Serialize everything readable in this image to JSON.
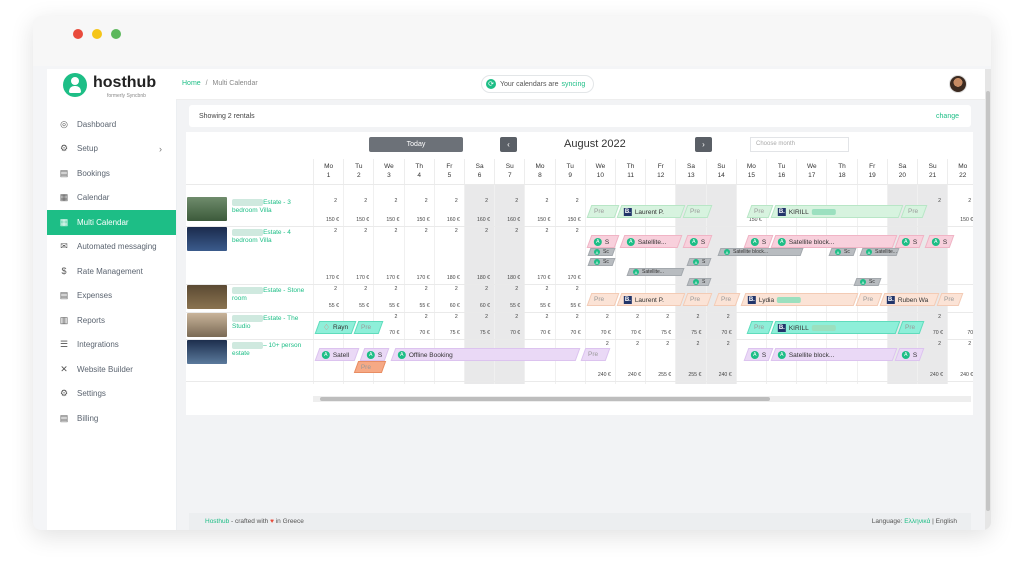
{
  "window": {
    "controls": [
      "close",
      "minimize",
      "maximize"
    ],
    "control_colors": [
      "#e94b3c",
      "#f5c518",
      "#5cb85c"
    ]
  },
  "brand": {
    "name": "hosthub",
    "tagline": "formerly Syncbnb"
  },
  "sidebar": {
    "items": [
      {
        "label": "Dashboard",
        "icon": "dashboard-icon",
        "glyph": "◎"
      },
      {
        "label": "Setup",
        "icon": "gears-icon",
        "glyph": "⚙",
        "chevron": "›"
      },
      {
        "label": "Bookings",
        "icon": "bookings-icon",
        "glyph": "▤"
      },
      {
        "label": "Calendar",
        "icon": "calendar-icon",
        "glyph": "▦"
      },
      {
        "label": "Multi Calendar",
        "icon": "multi-calendar-icon",
        "glyph": "▦",
        "active": true
      },
      {
        "label": "Automated messaging",
        "icon": "envelope-icon",
        "glyph": "✉"
      },
      {
        "label": "Rate Management",
        "icon": "dollar-icon",
        "glyph": "$"
      },
      {
        "label": "Expenses",
        "icon": "receipt-icon",
        "glyph": "▤"
      },
      {
        "label": "Reports",
        "icon": "chart-icon",
        "glyph": "▥"
      },
      {
        "label": "Integrations",
        "icon": "database-icon",
        "glyph": "☰"
      },
      {
        "label": "Website Builder",
        "icon": "tools-icon",
        "glyph": "✕"
      },
      {
        "label": "Settings",
        "icon": "gear-icon",
        "glyph": "⚙"
      },
      {
        "label": "Billing",
        "icon": "file-icon",
        "glyph": "▤"
      }
    ]
  },
  "topbar": {
    "breadcrumb_home": "Home",
    "breadcrumb_sep": "/",
    "breadcrumb_current": "Multi Calendar",
    "sync_text": "Your calendars are",
    "sync_state": "syncing"
  },
  "rentals_bar": {
    "showing": "Showing 2 rentals",
    "change": "change"
  },
  "calendar": {
    "today_label": "Today",
    "prev": "‹",
    "next": "›",
    "month": "August 2022",
    "month_placeholder": "Choose month",
    "days": [
      {
        "d": "Mo",
        "n": "1"
      },
      {
        "d": "Tu",
        "n": "2"
      },
      {
        "d": "We",
        "n": "3"
      },
      {
        "d": "Th",
        "n": "4"
      },
      {
        "d": "Fr",
        "n": "5"
      },
      {
        "d": "Sa",
        "n": "6",
        "w": true
      },
      {
        "d": "Su",
        "n": "7",
        "w": true
      },
      {
        "d": "Mo",
        "n": "8"
      },
      {
        "d": "Tu",
        "n": "9"
      },
      {
        "d": "We",
        "n": "10"
      },
      {
        "d": "Th",
        "n": "11"
      },
      {
        "d": "Fr",
        "n": "12"
      },
      {
        "d": "Sa",
        "n": "13",
        "w": true
      },
      {
        "d": "Su",
        "n": "14",
        "w": true
      },
      {
        "d": "Mo",
        "n": "15"
      },
      {
        "d": "Tu",
        "n": "16"
      },
      {
        "d": "We",
        "n": "17"
      },
      {
        "d": "Th",
        "n": "18"
      },
      {
        "d": "Fr",
        "n": "19"
      },
      {
        "d": "Sa",
        "n": "20",
        "w": true
      },
      {
        "d": "Su",
        "n": "21",
        "w": true
      },
      {
        "d": "Mo",
        "n": "22"
      }
    ],
    "rentals": [
      {
        "name_suffix": "Estate - 3 bedroom Villa",
        "photo": "villa-photo",
        "min_stay": [
          "2",
          "2",
          "2",
          "2",
          "2",
          "2",
          "2",
          "2",
          "2",
          "",
          "",
          "",
          "",
          "",
          "",
          "",
          "",
          "",
          "",
          "",
          "2",
          "2"
        ],
        "prices": [
          "150 €",
          "150 €",
          "150 €",
          "150 €",
          "160 €",
          "160 €",
          "160 €",
          "150 €",
          "150 €",
          "",
          "",
          "",
          "",
          "",
          "150 €",
          "",
          "",
          "",
          "",
          "",
          "",
          "150 €"
        ],
        "bookings": [
          {
            "label": "Pre",
            "color": "green",
            "start": 9,
            "span": 1.0,
            "kind": "pre"
          },
          {
            "label": "Laurent P.",
            "color": "green",
            "start": 10,
            "span": 2.2,
            "kind": "booking"
          },
          {
            "label": "Pre",
            "color": "green",
            "start": 12.2,
            "span": 0.9,
            "kind": "pre"
          },
          {
            "label": "Pre",
            "color": "green",
            "start": 14.3,
            "span": 0.8,
            "kind": "pre"
          },
          {
            "label": "KIRILL",
            "color": "green",
            "start": 15.1,
            "span": 4.3,
            "kind": "booking"
          },
          {
            "label": "Pre",
            "color": "green",
            "start": 19.4,
            "span": 0.8,
            "kind": "pre"
          }
        ]
      },
      {
        "name_suffix": "Estate - 4 bedroom Villa",
        "photo": "night-villa-photo",
        "min_stay": [
          "2",
          "2",
          "2",
          "2",
          "2",
          "2",
          "2",
          "2",
          "2",
          "",
          "",
          "",
          "",
          "",
          "",
          "",
          "",
          "",
          "",
          "",
          "",
          ""
        ],
        "prices": [
          "170 €",
          "170 €",
          "170 €",
          "170 €",
          "180 €",
          "180 €",
          "180 €",
          "170 €",
          "170 €",
          "",
          "",
          "",
          "",
          "",
          "",
          "",
          "",
          "",
          "",
          "",
          "",
          ""
        ],
        "bookings": [
          {
            "label": "S",
            "color": "pink",
            "start": 9,
            "span": 1.0,
            "kind": "airbnb"
          },
          {
            "label": "Satellite...",
            "color": "pink",
            "start": 10.1,
            "span": 2.0,
            "kind": "airbnb"
          },
          {
            "label": "S",
            "color": "pink",
            "start": 12.2,
            "span": 0.9,
            "kind": "airbnb"
          },
          {
            "label": "S",
            "color": "pink",
            "start": 14.2,
            "span": 0.9,
            "kind": "airbnb"
          },
          {
            "label": "Satellite block...",
            "color": "pink",
            "start": 15.1,
            "span": 4.1,
            "kind": "airbnb"
          },
          {
            "label": "S",
            "color": "pink",
            "start": 19.2,
            "span": 0.9,
            "kind": "airbnb"
          },
          {
            "label": "S",
            "color": "pink",
            "start": 20.2,
            "span": 0.9,
            "kind": "airbnb"
          }
        ]
      },
      {
        "name_suffix": "Estate - Stone room",
        "photo": "stone-room-photo",
        "min_stay": [
          "2",
          "2",
          "2",
          "2",
          "2",
          "2",
          "2",
          "2",
          "2",
          "",
          "",
          "",
          "",
          "",
          "",
          "",
          "",
          "",
          "",
          "",
          "",
          ""
        ],
        "prices": [
          "55 €",
          "55 €",
          "55 €",
          "55 €",
          "60 €",
          "60 €",
          "55 €",
          "55 €",
          "55 €",
          "",
          "",
          "",
          "",
          "",
          "",
          "",
          "",
          "",
          "",
          "",
          "",
          ""
        ],
        "bookings": [
          {
            "label": "Pre",
            "color": "peach",
            "start": 9,
            "span": 1.0,
            "kind": "pre"
          },
          {
            "label": "Laurent P.",
            "color": "peach",
            "start": 10,
            "span": 2.2,
            "kind": "booking"
          },
          {
            "label": "Pre",
            "color": "peach",
            "start": 12.2,
            "span": 0.9,
            "kind": "pre"
          },
          {
            "label": "Pre",
            "color": "peach",
            "start": 13.2,
            "span": 0.8,
            "kind": "pre"
          },
          {
            "label": "Lydia",
            "color": "peach",
            "start": 14.1,
            "span": 3.8,
            "kind": "booking"
          },
          {
            "label": "Pre",
            "color": "peach",
            "start": 17.9,
            "span": 0.8,
            "kind": "pre"
          },
          {
            "label": "Ruben Wa",
            "color": "peach",
            "start": 18.7,
            "span": 1.9,
            "kind": "booking"
          },
          {
            "label": "Pre",
            "color": "peach",
            "start": 20.6,
            "span": 0.8,
            "kind": "pre"
          }
        ]
      },
      {
        "name_suffix": "Estate - The Studio",
        "photo": "studio-photo",
        "min_stay": [
          "",
          "",
          "2",
          "2",
          "2",
          "2",
          "2",
          "2",
          "2",
          "2",
          "2",
          "2",
          "2",
          "2",
          "",
          "",
          "",
          "",
          "",
          "",
          "2",
          ""
        ],
        "prices": [
          "",
          "",
          "70 €",
          "70 €",
          "75 €",
          "75 €",
          "70 €",
          "70 €",
          "70 €",
          "70 €",
          "70 €",
          "75 €",
          "75 €",
          "70 €",
          "",
          "",
          "",
          "",
          "",
          "",
          "70 €",
          "70"
        ],
        "bookings": [
          {
            "label": "Rayn",
            "color": "cyan",
            "start": 0,
            "span": 1.3,
            "kind": "airbnb-logo"
          },
          {
            "label": "Pre",
            "color": "cyan",
            "start": 1.3,
            "span": 0.9,
            "kind": "pre"
          },
          {
            "label": "Pre",
            "color": "cyan",
            "start": 14.3,
            "span": 0.8,
            "kind": "pre"
          },
          {
            "label": "KIRILL",
            "color": "cyan",
            "start": 15.1,
            "span": 4.2,
            "kind": "booking"
          },
          {
            "label": "Pre",
            "color": "cyan",
            "start": 19.3,
            "span": 0.8,
            "kind": "pre"
          }
        ]
      },
      {
        "name_suffix": "– 10+ person estate",
        "photo": "estate-photo",
        "min_stay": [
          "",
          "",
          "",
          "",
          "",
          "",
          "",
          "",
          "",
          "2",
          "2",
          "2",
          "2",
          "2",
          "",
          "",
          "",
          "",
          "",
          "",
          "2",
          "2"
        ],
        "prices": [
          "",
          "",
          "",
          "",
          "",
          "",
          "",
          "",
          "",
          "240 €",
          "240 €",
          "255 €",
          "255 €",
          "240 €",
          "",
          "",
          "",
          "",
          "",
          "",
          "240 €",
          "240 €"
        ],
        "bookings": [
          {
            "label": "Satell",
            "color": "lilac",
            "start": 0,
            "span": 1.4,
            "kind": "airbnb"
          },
          {
            "label": "S",
            "color": "lilac",
            "start": 1.5,
            "span": 0.9,
            "kind": "airbnb"
          },
          {
            "label": "Offline Booking",
            "color": "lilac",
            "start": 2.5,
            "span": 6.2,
            "kind": "airbnb"
          },
          {
            "label": "Pre",
            "color": "lilac",
            "start": 8.8,
            "span": 0.9,
            "kind": "pre"
          },
          {
            "label": "S",
            "color": "lilac",
            "start": 14.2,
            "span": 0.9,
            "kind": "airbnb"
          },
          {
            "label": "Satellite block...",
            "color": "lilac",
            "start": 15.1,
            "span": 4.1,
            "kind": "airbnb"
          },
          {
            "label": "S",
            "color": "lilac",
            "start": 19.2,
            "span": 0.9,
            "kind": "airbnb"
          }
        ]
      }
    ],
    "substack": [
      {
        "label": "Sc",
        "row": 1,
        "start": 9.0,
        "span": 0.9
      },
      {
        "label": "Sc",
        "row": 1,
        "start": 9.0,
        "span": 0.9,
        "line": 2
      },
      {
        "label": "Satellite...",
        "row": 1,
        "start": 10.3,
        "span": 1.9,
        "line": 3
      },
      {
        "label": "S",
        "row": 1,
        "start": 12.3,
        "span": 0.8,
        "line": 2
      },
      {
        "label": "S",
        "row": 1,
        "start": 12.3,
        "span": 0.8,
        "line": 4
      },
      {
        "label": "Satellite block...",
        "row": 1,
        "start": 13.3,
        "span": 2.8,
        "line": 1
      },
      {
        "label": "Sc",
        "row": 1,
        "start": 17.0,
        "span": 0.9,
        "line": 1
      },
      {
        "label": "Satellite...",
        "row": 1,
        "start": 18.0,
        "span": 1.3,
        "line": 1
      },
      {
        "label": "Sc",
        "row": 1,
        "start": 17.8,
        "span": 0.9,
        "line": 4
      },
      {
        "label": "Pre",
        "row": 4,
        "start": 1.3,
        "span": 1.0,
        "line": 1,
        "color": "orange"
      }
    ]
  },
  "footer": {
    "brand": "Hosthub",
    "crafted": "- crafted with",
    "heart": "♥",
    "location": "in Greece",
    "language_label": "Language:",
    "language_alt": "Ελληνικά",
    "language_current": "English"
  }
}
